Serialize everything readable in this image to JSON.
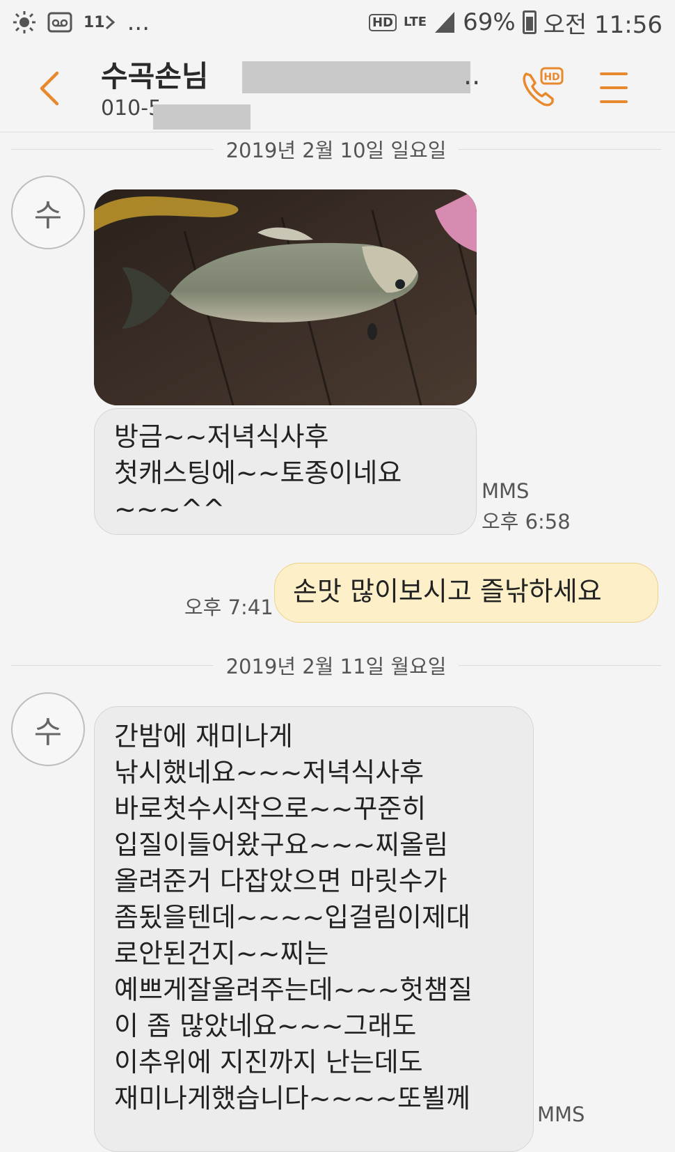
{
  "status_bar": {
    "notif_count": "11",
    "more": "...",
    "hd": "HD",
    "network": "LTE",
    "battery": "69%",
    "time": "오전 11:56"
  },
  "header": {
    "contact_name": "수곡손님",
    "contact_name_extra": "..",
    "phone": "010-5"
  },
  "conversation": {
    "date1": "2019년 2월 10일 일요일",
    "avatar_initial": "수",
    "msg1_lines": [
      "방금~~저녁식사후",
      "첫캐스팅에~~토종이네요",
      "~~~^^"
    ],
    "msg1_type": "MMS",
    "msg1_time": "오후 6:58",
    "msg2_text": "손맛 많이보시고 즐낚하세요",
    "msg2_time": "오후 7:41",
    "date2": "2019년 2월 11일 월요일",
    "avatar2_initial": "수",
    "msg3_lines": [
      "간밤에 재미나게",
      "낚시했네요~~~저녁식사후",
      "바로첫수시작으로~~꾸준히",
      "입질이들어왔구요~~~찌올림",
      "올려준거 다잡았으면 마릿수가",
      "좀됬을텐데~~~~입걸림이제대",
      "로안된건지~~찌는",
      "예쁘게잘올려주는데~~~헛챔질",
      "이 좀 많았네요~~~그래도",
      "이추위에 지진까지 난는데도",
      "재미나게했습니다~~~~또뵐께"
    ],
    "msg3_type": "MMS"
  },
  "colors": {
    "accent": "#e8892e",
    "incoming_bubble": "#ececec",
    "outgoing_bubble": "#fdf0c9"
  }
}
